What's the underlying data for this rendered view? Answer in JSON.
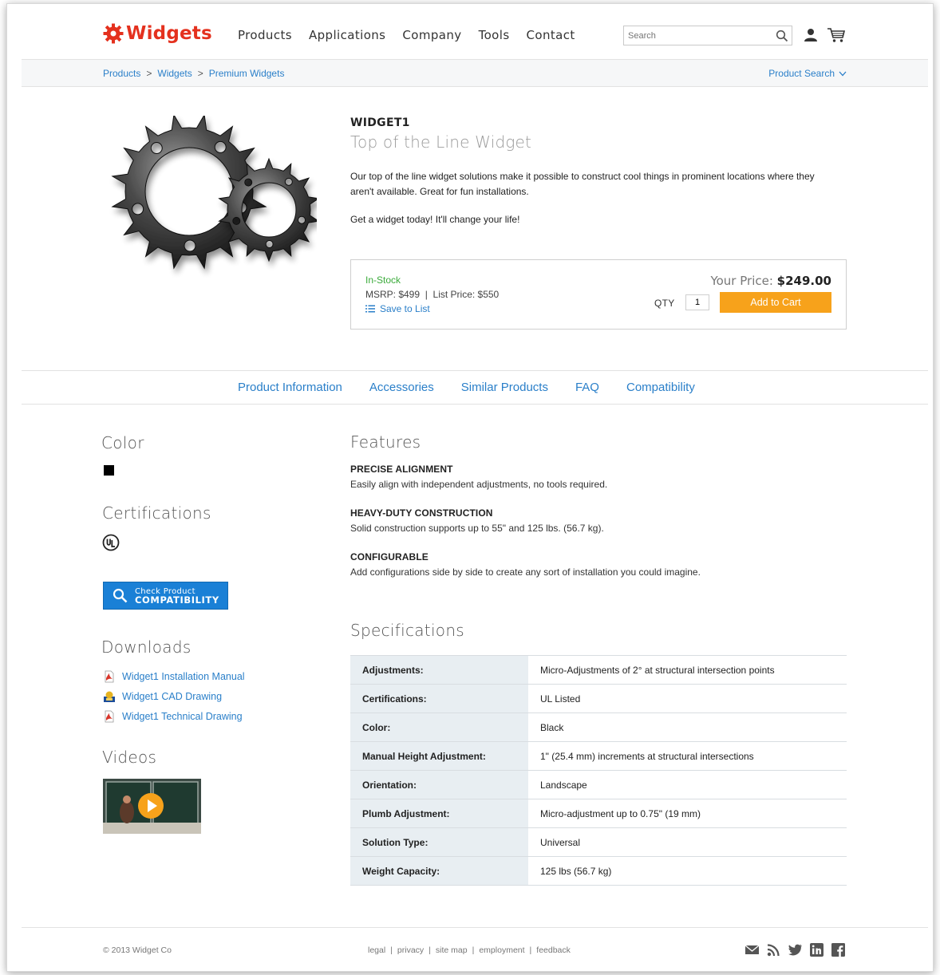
{
  "header": {
    "logo_text": "Widgets",
    "nav": [
      "Products",
      "Applications",
      "Company",
      "Tools",
      "Contact"
    ],
    "search_placeholder": "Search"
  },
  "breadcrumb": {
    "items": [
      "Products",
      "Widgets",
      "Premium Widgets"
    ],
    "separator": ">",
    "product_search": "Product Search"
  },
  "product": {
    "sku": "WIDGET1",
    "name": "Top of the Line Widget",
    "description": "Our top of the line widget solutions make it possible to construct cool things in prominent locations where they aren't available. Great for fun installations.",
    "tagline": "Get a widget today! It'll change your life!",
    "stock": "In-Stock",
    "msrp": "MSRP: $499",
    "list_price": "List Price: $550",
    "price_sep": "|",
    "save_to_list": "Save to List",
    "your_price_label": "Your Price:",
    "your_price": "$249.00",
    "qty_label": "QTY",
    "qty_value": "1",
    "add_to_cart": "Add to Cart"
  },
  "tabs": [
    "Product Information",
    "Accessories",
    "Similar Products",
    "FAQ",
    "Compatibility"
  ],
  "sidebar": {
    "color_title": "Color",
    "certifications_title": "Certifications",
    "check_small": "Check Product",
    "check_big": "COMPATIBILITY",
    "downloads_title": "Downloads",
    "downloads": [
      "Widget1 Installation Manual",
      "Widget1 CAD Drawing",
      "Widget1 Technical Drawing"
    ],
    "videos_title": "Videos"
  },
  "features": {
    "title": "Features",
    "items": [
      {
        "title": "PRECISE ALIGNMENT",
        "desc": "Easily align with independent adjustments, no tools required."
      },
      {
        "title": "HEAVY-DUTY CONSTRUCTION",
        "desc": "Solid construction supports up to 55\" and 125 lbs. (56.7 kg)."
      },
      {
        "title": "CONFIGURABLE",
        "desc": "Add configurations side by side to create any sort of installation you could imagine."
      }
    ]
  },
  "specifications": {
    "title": "Specifications",
    "rows": [
      {
        "key": "Adjustments:",
        "value": "Micro-Adjustments of 2° at structural intersection points"
      },
      {
        "key": "Certifications:",
        "value": "UL Listed"
      },
      {
        "key": "Color:",
        "value": "Black"
      },
      {
        "key": "Manual Height Adjustment:",
        "value": "1\" (25.4 mm) increments at structural intersections"
      },
      {
        "key": "Orientation:",
        "value": "Landscape"
      },
      {
        "key": "Plumb Adjustment:",
        "value": "Micro-adjustment up to 0.75\" (19 mm)"
      },
      {
        "key": "Solution Type:",
        "value": "Universal"
      },
      {
        "key": "Weight Capacity:",
        "value": "125 lbs (56.7 kg)"
      }
    ]
  },
  "footer": {
    "copyright": "© 2013 Widget Co",
    "links": [
      "legal",
      "privacy",
      "site map",
      "employment",
      "feedback"
    ],
    "link_sep": "|"
  },
  "colors": {
    "brand": "#e4311e",
    "link": "#2a7fc9",
    "cta": "#f7a21b",
    "in_stock": "#3bab3b",
    "button_blue": "#1a80d6"
  },
  "icons": [
    "gear-logo-icon",
    "search-icon",
    "user-icon",
    "cart-icon",
    "chevron-down-icon",
    "list-icon",
    "ul-certification-icon",
    "pdf-icon",
    "cad-icon",
    "play-icon",
    "email-icon",
    "rss-icon",
    "twitter-icon",
    "linkedin-icon",
    "facebook-icon"
  ]
}
